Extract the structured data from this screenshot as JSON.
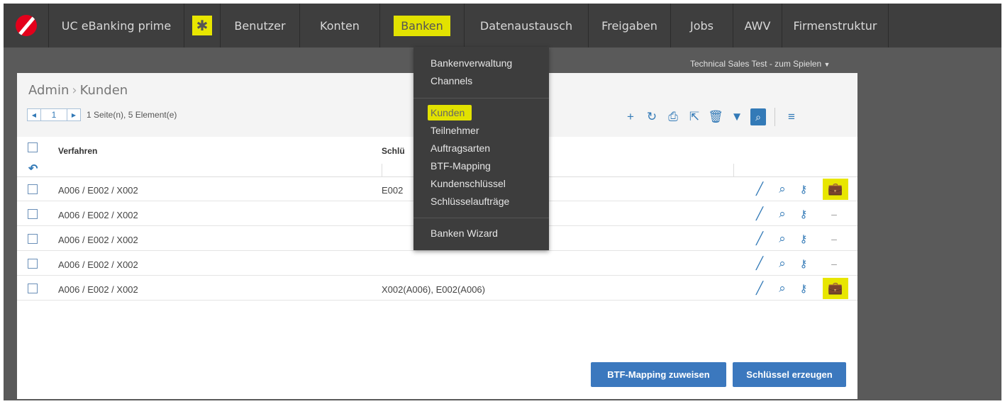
{
  "app": {
    "title": "UC eBanking prime"
  },
  "nav": [
    "Benutzer",
    "Konten",
    "Banken",
    "Datenaustausch",
    "Freigaben",
    "Jobs",
    "AWV",
    "Firmenstruktur"
  ],
  "tenant": "Technical Sales Test - zum Spielen",
  "breadcrumb": {
    "parent": "Admin",
    "sep": "›",
    "current": "Kunden"
  },
  "pager": {
    "page": "1",
    "info": "1 Seite(n), 5 Element(e)"
  },
  "table": {
    "headers": [
      "Verfahren",
      "Schlü"
    ],
    "rows": [
      {
        "verfahren": "A006 / E002 / X002",
        "schluessel": "E002",
        "ext": "briefcase"
      },
      {
        "verfahren": "A006 / E002 / X002",
        "schluessel": "",
        "ext": "dash"
      },
      {
        "verfahren": "A006 / E002 / X002",
        "schluessel": "",
        "ext": "dash"
      },
      {
        "verfahren": "A006 / E002 / X002",
        "schluessel": "",
        "ext": "dash"
      },
      {
        "verfahren": "A006 / E002 / X002",
        "schluessel": "X002(A006), E002(A006)",
        "ext": "briefcase"
      }
    ]
  },
  "buttons": {
    "btf": "BTF-Mapping zuweisen",
    "keys": "Schlüssel erzeugen"
  },
  "menu": {
    "group1": [
      "Bankenverwaltung",
      "Channels"
    ],
    "group2": [
      "Kunden",
      "Teilnehmer",
      "Auftragsarten",
      "BTF-Mapping",
      "Kundenschlüssel",
      "Schlüsselaufträge"
    ],
    "group3": [
      "Banken Wizard"
    ]
  },
  "colors": {
    "accent": "#337ab7",
    "highlight": "#e2e200",
    "navbar": "#3e3e3e"
  }
}
